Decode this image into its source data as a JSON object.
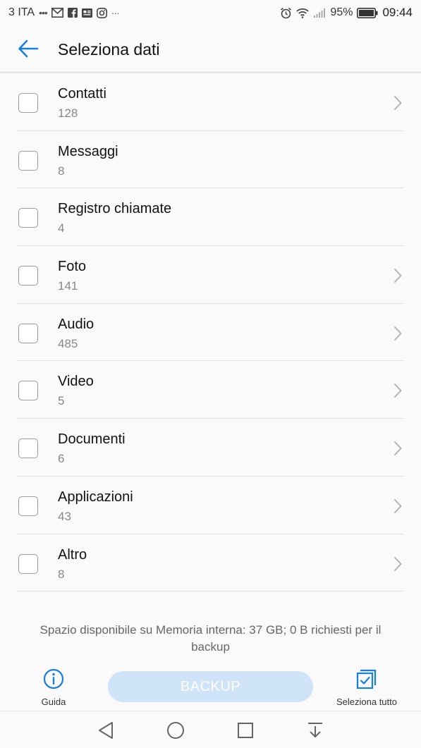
{
  "status_bar": {
    "carrier": "3 ITA",
    "battery_percent": "95%",
    "time": "09:44",
    "icons": [
      "signal-dots-icon",
      "gmail-icon",
      "facebook-icon",
      "news-icon",
      "instagram-icon",
      "more-icon",
      "alarm-icon",
      "wifi-icon",
      "signal-icon",
      "battery-icon"
    ]
  },
  "header": {
    "title": "Seleziona dati",
    "back_icon": "arrow-left-icon"
  },
  "items": [
    {
      "label": "Contatti",
      "count": "128",
      "has_chevron": true
    },
    {
      "label": "Messaggi",
      "count": "8",
      "has_chevron": false
    },
    {
      "label": "Registro chiamate",
      "count": "4",
      "has_chevron": false
    },
    {
      "label": "Foto",
      "count": "141",
      "has_chevron": true
    },
    {
      "label": "Audio",
      "count": "485",
      "has_chevron": true
    },
    {
      "label": "Video",
      "count": "5",
      "has_chevron": true
    },
    {
      "label": "Documenti",
      "count": "6",
      "has_chevron": true
    },
    {
      "label": "Applicazioni",
      "count": "43",
      "has_chevron": true
    },
    {
      "label": "Altro",
      "count": "8",
      "has_chevron": true
    }
  ],
  "storage_info": "Spazio disponibile su Memoria interna: 37 GB; 0 B richiesti per il backup",
  "toolbar": {
    "guide_label": "Guida",
    "backup_label": "BACKUP",
    "select_all_label": "Seleziona tutto"
  },
  "colors": {
    "accent": "#1a7ee0",
    "backup_disabled": "#cfe3f9"
  }
}
